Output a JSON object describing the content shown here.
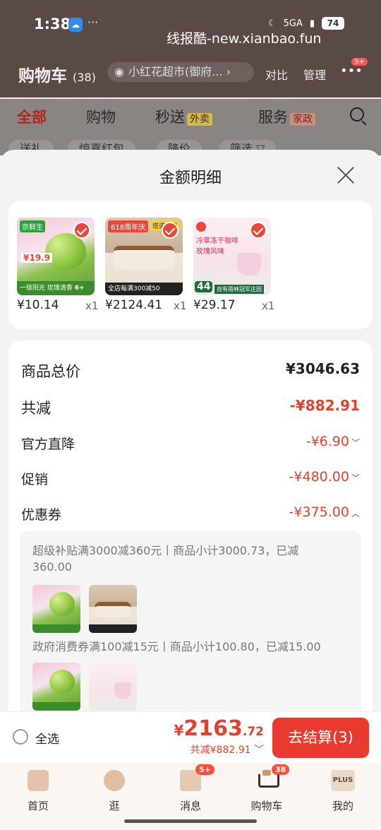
{
  "status_bar": {
    "time": "1:38",
    "app_icon": "cloud",
    "dots": "···",
    "network": "5GA",
    "battery": "74"
  },
  "watermark": "线报酷-new.xianbao.fun",
  "header": {
    "title": "购物车",
    "count": "(38)",
    "store": "小红花超市(御府...",
    "compare": "对比",
    "manage": "管理",
    "more_badge": "5+"
  },
  "tabs": [
    {
      "label": "全部",
      "tag": ""
    },
    {
      "label": "购物",
      "tag": ""
    },
    {
      "label": "秒送",
      "tag": "外卖"
    },
    {
      "label": "服务",
      "tag": "家政"
    }
  ],
  "chips": [
    "送礼",
    "惊喜红包",
    "降价",
    "筛选 ▽"
  ],
  "sheet": {
    "title": "金额明细",
    "products": [
      {
        "price": "¥10.14",
        "qty": "x1",
        "label_top": "京鲜生",
        "price_tag": "¥19.9",
        "band": "一级阳光 玫瑰清香",
        "corner": "6+"
      },
      {
        "price": "¥2124.41",
        "qty": "x1",
        "ribbon": "618周年庆",
        "brand": "塔诺家具",
        "band": "全店每满300减50"
      },
      {
        "price": "¥29.17",
        "qty": "x1",
        "name": "冷萃冻干咖啡 玫瑰风味",
        "badge": "44",
        "band": "自有雨林冠军庄园"
      }
    ],
    "rows": {
      "total_label": "商品总价",
      "total_value": "¥3046.63",
      "discount_label": "共减",
      "discount_value": "-¥882.91",
      "official_label": "官方直降",
      "official_value": "-¥6.90",
      "promo_label": "促销",
      "promo_value": "-¥480.00",
      "coupon_label": "优惠券",
      "coupon_value": "-¥375.00"
    },
    "coupon_details": [
      {
        "text": "超级补贴满3000减360元丨商品小计3000.73，已减360.00"
      },
      {
        "text": "政府消费券满100减15元丨商品小计100.80，已减15.00"
      }
    ]
  },
  "checkout": {
    "select_all": "全选",
    "yen": "¥",
    "total_int": "2163",
    "total_dec": ".72",
    "saved": "共减¥882.91",
    "button": "去结算(3)"
  },
  "bottom_nav": [
    {
      "label": "首页",
      "badge": ""
    },
    {
      "label": "逛",
      "badge": ""
    },
    {
      "label": "消息",
      "badge": "5+"
    },
    {
      "label": "购物车",
      "badge": "38"
    },
    {
      "label": "我的",
      "badge": "",
      "icon_text": "PLUS"
    }
  ],
  "colors": {
    "accent_red": "#e83a2f",
    "discount_red": "#e0432f",
    "header_bg": "#5a4a46"
  }
}
